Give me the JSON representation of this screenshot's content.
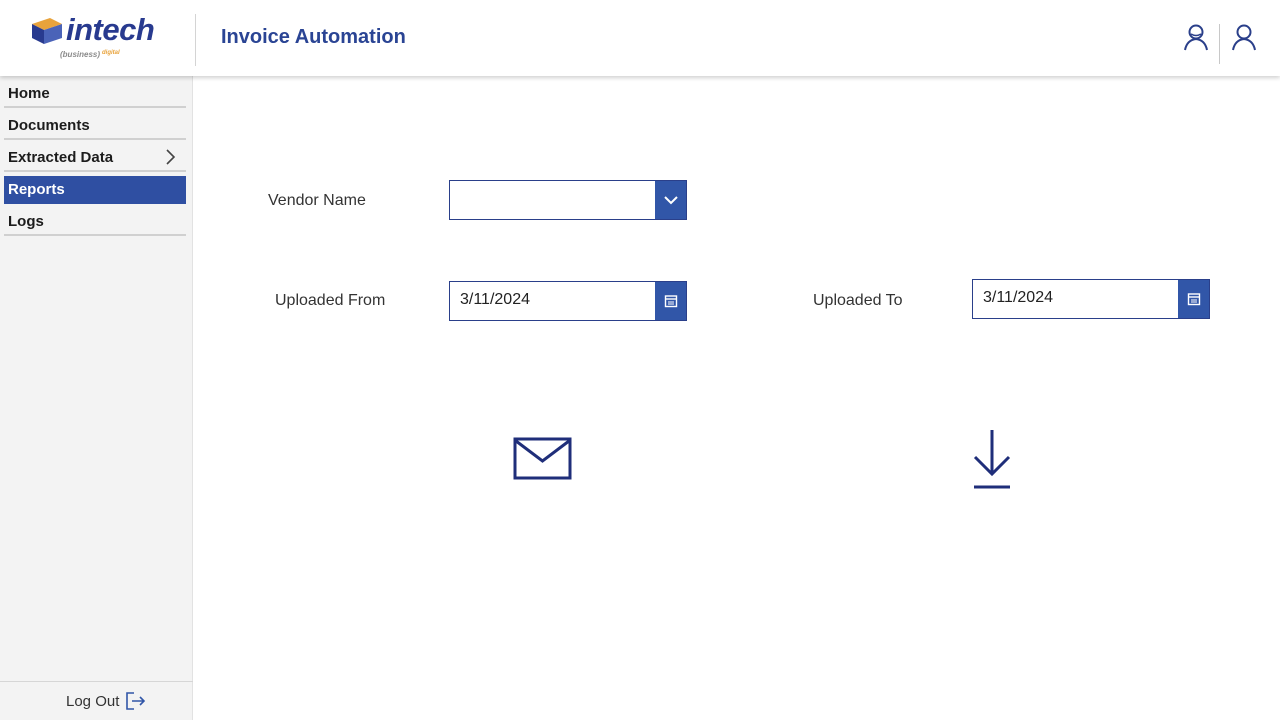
{
  "header": {
    "logo_text": "intech",
    "logo_sub": "(business)",
    "logo_digital": "digital",
    "title": "Invoice Automation",
    "icons": [
      "user-outline-icon",
      "user-icon"
    ]
  },
  "sidebar": {
    "items": [
      {
        "label": "Home",
        "active": false
      },
      {
        "label": "Documents",
        "active": false
      },
      {
        "label": "Extracted Data",
        "active": false,
        "has_submenu": true
      },
      {
        "label": "Reports",
        "active": true
      },
      {
        "label": "Logs",
        "active": false
      }
    ],
    "logout_label": "Log Out"
  },
  "form": {
    "vendor_label": "Vendor Name",
    "vendor_value": "",
    "uploaded_from_label": "Uploaded From",
    "uploaded_from_value": "3/11/2024",
    "uploaded_to_label": "Uploaded To",
    "uploaded_to_value": "3/11/2024"
  },
  "actions": [
    "email-icon",
    "download-icon"
  ],
  "colors": {
    "accent": "#2f4fa2",
    "title": "#2a4494",
    "icon_dark": "#1f2e7a"
  }
}
